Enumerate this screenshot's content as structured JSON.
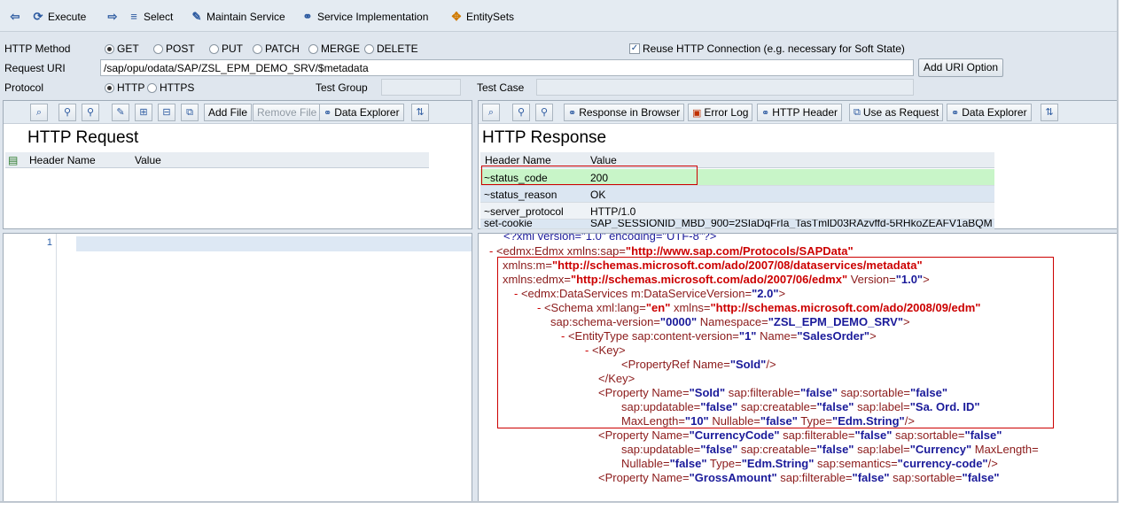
{
  "toolbar": {
    "execute": "Execute",
    "select": "Select",
    "maintain_service": "Maintain Service",
    "service_implementation": "Service Implementation",
    "entity_sets": "EntitySets"
  },
  "form": {
    "http_method_label": "HTTP Method",
    "methods": [
      "GET",
      "POST",
      "PUT",
      "PATCH",
      "MERGE",
      "DELETE"
    ],
    "reuse_label": "Reuse HTTP Connection (e.g. necessary for Soft State)",
    "request_uri_label": "Request URI",
    "request_uri_value": "/sap/opu/odata/SAP/ZSL_EPM_DEMO_SRV/$metadata",
    "add_uri_option": "Add URI Option",
    "protocol_label": "Protocol",
    "protocols": [
      "HTTP",
      "HTTPS"
    ],
    "test_group_label": "Test Group",
    "test_case_label": "Test Case"
  },
  "request_panel": {
    "title": "HTTP Request",
    "add_file": "Add File",
    "remove_file": "Remove File",
    "data_explorer": "Data Explorer",
    "col_header": "Header Name",
    "col_value": "Value",
    "line_no": "1"
  },
  "response_panel": {
    "title": "HTTP Response",
    "response_in_browser": "Response in Browser",
    "error_log": "Error Log",
    "http_header": "HTTP Header",
    "use_as_request": "Use as Request",
    "data_explorer": "Data Explorer",
    "col_header": "Header Name",
    "col_value": "Value",
    "rows": [
      {
        "name": "~status_code",
        "value": "200"
      },
      {
        "name": "~status_reason",
        "value": "OK"
      },
      {
        "name": "~server_protocol",
        "value": "HTTP/1.0"
      },
      {
        "name": "set-cookie",
        "value": "SAP_SESSIONID_MBD_900=2SIaDqFrIa_TasTmlD03RAzvffd-5RHkoZEAFV1aBQM"
      }
    ]
  },
  "xml": {
    "l0": "<?xml version=\"1.0\" encoding=\"UTF-8\"?>",
    "l1_tag": "<edmx:Edmx xmlns:sap=",
    "l1_val": "\"http://www.sap.com/Protocols/SAPData\"",
    "l2_attr": "xmlns:m=",
    "l2_val": "\"http://schemas.microsoft.com/ado/2007/08/dataservices/metadata\"",
    "l3_attr": "xmlns:edmx=",
    "l3_val": "\"http://schemas.microsoft.com/ado/2007/06/edmx\"",
    "l3_attr2": " Version=",
    "l3_val2": "\"1.0\"",
    "l3_end": ">",
    "l4_tag": "<edmx:DataServices m:DataServiceVersion=",
    "l4_val": "\"2.0\"",
    "l4_end": ">",
    "l5_tag": "<Schema xml:lang=",
    "l5_val": "\"en\"",
    "l5_attr": " xmlns=",
    "l5_val2": "\"http://schemas.microsoft.com/ado/2008/09/edm\"",
    "l6_attr": "sap:schema-version=",
    "l6_val": "\"0000\"",
    "l6_attr2": " Namespace=",
    "l6_val2": "\"ZSL_EPM_DEMO_SRV\"",
    "l6_end": ">",
    "l7_tag": "<EntityType sap:content-version=",
    "l7_val": "\"1\"",
    "l7_attr": " Name=",
    "l7_val2": "\"SalesOrder\"",
    "l7_end": ">",
    "l8": "<Key>",
    "l9_tag": "<PropertyRef Name=",
    "l9_val": "\"SoId\"",
    "l9_end": "/>",
    "l10": "</Key>",
    "l11_tag": "<Property Name=",
    "l11_val": "\"SoId\"",
    "l11_a": " sap:filterable=",
    "l11_v": "\"false\"",
    "l11_a2": " sap:sortable=",
    "l11_v2": "\"false\"",
    "l12_a": "sap:updatable=",
    "l12_v": "\"false\"",
    "l12_a2": " sap:creatable=",
    "l12_v2": "\"false\"",
    "l12_a3": " sap:label=",
    "l12_v3": "\"Sa. Ord. ID\"",
    "l13_a": "MaxLength=",
    "l13_v": "\"10\"",
    "l13_a2": " Nullable=",
    "l13_v2": "\"false\"",
    "l13_a3": " Type=",
    "l13_v3": "\"Edm.String\"",
    "l13_end": "/>",
    "l14_tag": "<Property Name=",
    "l14_val": "\"CurrencyCode\"",
    "l14_a": " sap:filterable=",
    "l14_v": "\"false\"",
    "l14_a2": " sap:sortable=",
    "l14_v2": "\"false\"",
    "l15_a": "sap:updatable=",
    "l15_v": "\"false\"",
    "l15_a2": " sap:creatable=",
    "l15_v2": "\"false\"",
    "l15_a3": " sap:label=",
    "l15_v3": "\"Currency\"",
    "l15_a4": " MaxLength=",
    "l16_a": "Nullable=",
    "l16_v": "\"false\"",
    "l16_a2": " Type=",
    "l16_v2": "\"Edm.String\"",
    "l16_a3": " sap:semantics=",
    "l16_v3": "\"currency-code\"",
    "l16_end": "/>",
    "l17_tag": "<Property Name=",
    "l17_val": "\"GrossAmount\"",
    "l17_a": " sap:filterable=",
    "l17_v": "\"false\"",
    "l17_a2": " sap:sortable=",
    "l17_v2": "\"false\""
  }
}
